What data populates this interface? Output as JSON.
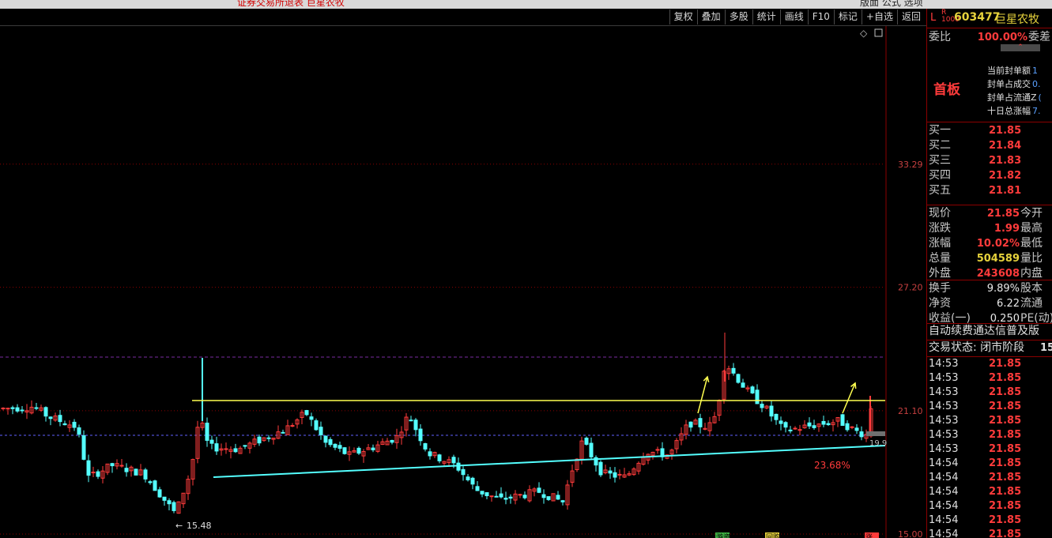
{
  "topbar": {
    "left_text": "证券交易所退表 巨星农牧",
    "right_text": "版面 公式 选项"
  },
  "toolbar": {
    "buttons": [
      "复权",
      "叠加",
      "多股",
      "统计",
      "画线",
      "F10",
      "标记",
      "+自选",
      "返回"
    ]
  },
  "chart": {
    "price_labels": [
      "33.29",
      "27.20",
      "21.10",
      "15.00"
    ],
    "low_label": "15.48",
    "pct_label": "23.68%",
    "right_cut_label": "19.9",
    "bottom_labels": [
      "游资",
      "回购",
      "涨"
    ],
    "colors": {
      "up": "#ff3b3b",
      "down": "#54ffff",
      "yellow_line": "#ffff50",
      "cyan_line": "#54ffff",
      "grid": "#8b0000",
      "dash": "#7a2da0"
    }
  },
  "panel": {
    "prefix": "L",
    "sub": "R",
    "sub2": "1000",
    "code": "603477",
    "name": "巨星农牧",
    "wb_label": "委比",
    "wb_value": "100.00%",
    "wc_label": "委差",
    "first_board": "首板",
    "seal": [
      {
        "label": "当前封单额",
        "value": "1"
      },
      {
        "label": "封单占成交",
        "value": "0."
      },
      {
        "label": "封单占流通Z",
        "value": "("
      },
      {
        "label": "十日总涨幅",
        "value": "7."
      }
    ],
    "bids": [
      {
        "label": "买一",
        "value": "21.85"
      },
      {
        "label": "买二",
        "value": "21.84"
      },
      {
        "label": "买三",
        "value": "21.83"
      },
      {
        "label": "买四",
        "value": "21.82"
      },
      {
        "label": "买五",
        "value": "21.81"
      }
    ],
    "quote": [
      {
        "label": "现价",
        "value": "21.85",
        "label2": "今开",
        "style": "red"
      },
      {
        "label": "涨跌",
        "value": "1.99",
        "label2": "最高",
        "style": "red"
      },
      {
        "label": "涨幅",
        "value": "10.02%",
        "label2": "最低",
        "style": "red"
      },
      {
        "label": "总量",
        "value": "504589",
        "label2": "量比",
        "style": "yellow"
      },
      {
        "label": "外盘",
        "value": "243608",
        "label2": "内盘",
        "style": "red"
      }
    ],
    "fund": [
      {
        "label": "换手",
        "value": "9.89%",
        "label2": "股本"
      },
      {
        "label": "净资",
        "value": "6.22",
        "label2": "流通"
      },
      {
        "label": "收益(一)",
        "value": "0.250",
        "label2": "PE(动)"
      }
    ],
    "promo": "自动续费通达信普及版",
    "status_label": "交易状态: 闭市阶段",
    "status_value": "15",
    "ticks": [
      {
        "time": "14:53",
        "price": "21.85"
      },
      {
        "time": "14:53",
        "price": "21.85"
      },
      {
        "time": "14:53",
        "price": "21.85"
      },
      {
        "time": "14:53",
        "price": "21.85"
      },
      {
        "time": "14:53",
        "price": "21.85"
      },
      {
        "time": "14:53",
        "price": "21.85"
      },
      {
        "time": "14:53",
        "price": "21.85"
      },
      {
        "time": "14:54",
        "price": "21.85"
      },
      {
        "time": "14:54",
        "price": "21.85"
      },
      {
        "time": "14:54",
        "price": "21.85"
      },
      {
        "time": "14:54",
        "price": "21.85"
      },
      {
        "time": "14:54",
        "price": "21.85"
      },
      {
        "time": "14:54",
        "price": "21.85"
      }
    ]
  }
}
